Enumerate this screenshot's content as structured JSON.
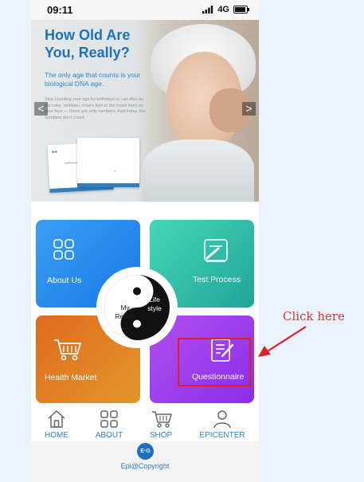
{
  "status_bar": {
    "time": "09:11",
    "network": "4G"
  },
  "banner": {
    "title": "How Old Are You, Really?",
    "subtitle": "The only age that counts is your biological DNA age.",
    "body": "Stop counting your age by birthdays or can-dles on the cake, wrinkles, crow's feet or the frown lines on your face — those are only numbers. And today, the numbers don't count.",
    "prev_label": "<",
    "next_label": ">"
  },
  "tiles": {
    "about": {
      "label": "About Us",
      "icon": "grid-icon"
    },
    "test": {
      "label": "Test Process",
      "icon": "checklist-edit-icon"
    },
    "health": {
      "label": "Health Market",
      "icon": "shopping-cart-icon"
    },
    "quest": {
      "label": "Questionnaire",
      "icon": "document-edit-icon"
    }
  },
  "center": {
    "my_report": "My Report",
    "lifestyle": "Life style"
  },
  "nav": [
    {
      "label": "HOME",
      "icon": "home-icon"
    },
    {
      "label": "ABOUT",
      "icon": "grid-icon"
    },
    {
      "label": "SHOP",
      "icon": "shopping-cart-icon"
    },
    {
      "label": "EPICENTER",
      "icon": "user-icon"
    }
  ],
  "footer": {
    "logo_text": "E·G",
    "copyright": "Epi@Copyright"
  },
  "annotation": {
    "click_here": "Click here",
    "color": "#e02020"
  },
  "colors": {
    "about": "#1f86ee",
    "test": "#2fbfa8",
    "health": "#e07a22",
    "quest": "#a040ec",
    "nav_text": "#2f86c6"
  }
}
